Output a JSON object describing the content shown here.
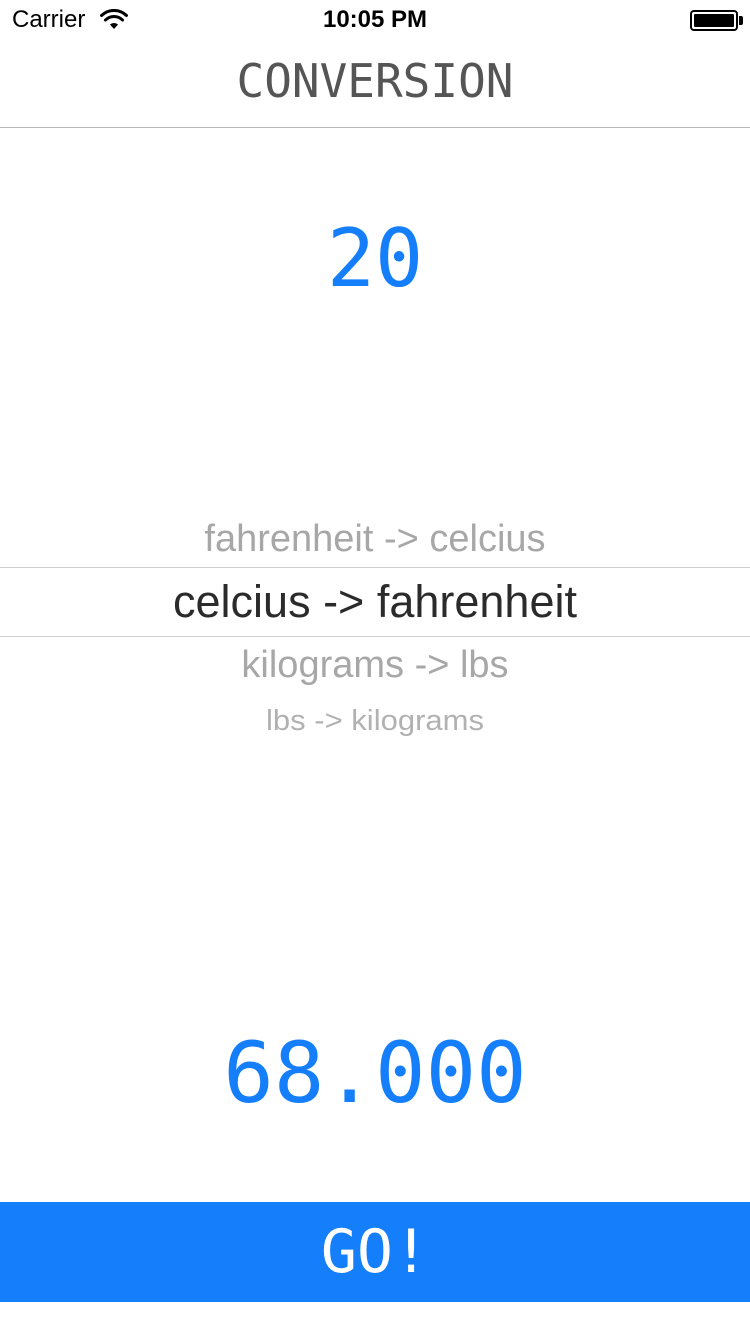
{
  "status_bar": {
    "carrier": "Carrier",
    "time": "10:05 PM",
    "wifi_icon": "wifi-icon",
    "battery_icon": "battery-icon"
  },
  "nav": {
    "title": "CONVERSION"
  },
  "input": {
    "value": "20"
  },
  "picker": {
    "selected": "celcius -> fahrenheit",
    "options": [
      "fahrenheit -> celcius",
      "celcius -> fahrenheit",
      "kilograms -> lbs",
      "lbs -> kilograms"
    ]
  },
  "result": {
    "value": "68.000"
  },
  "go_button": {
    "label": "GO!"
  },
  "colors": {
    "accent": "#147efb",
    "title_text": "#555555",
    "picker_selected": "#2b2b2b",
    "picker_unselected": "#a7a7a7"
  }
}
